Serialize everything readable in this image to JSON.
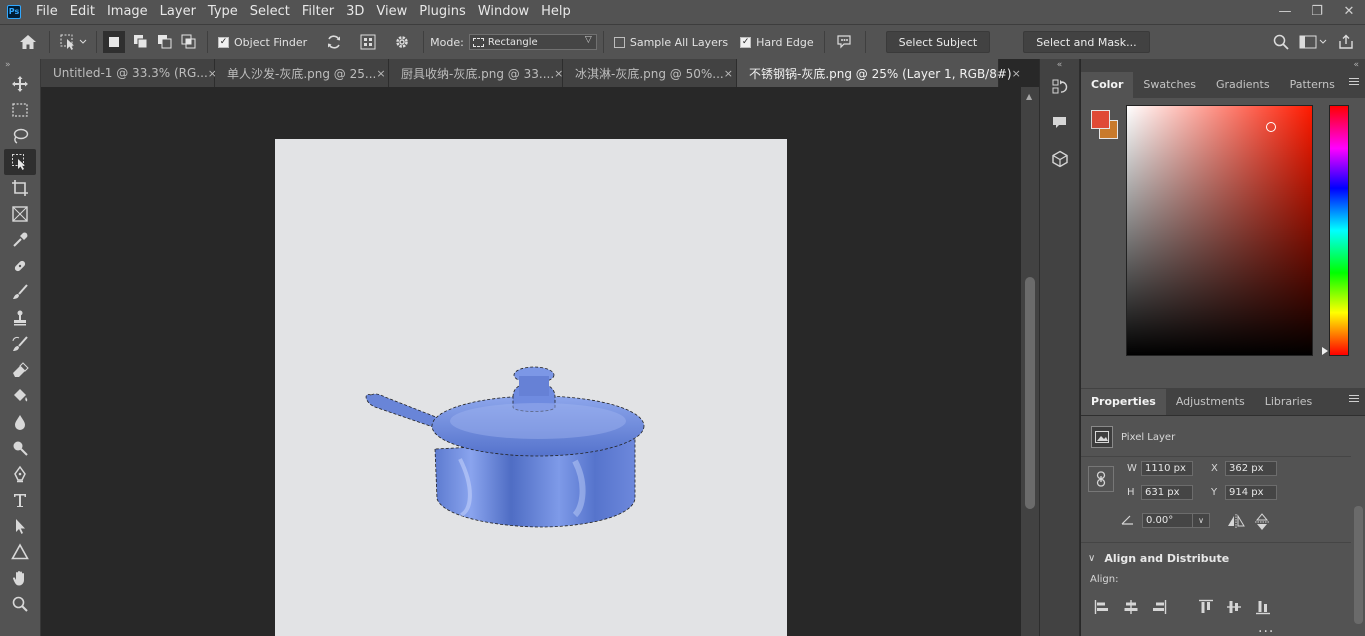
{
  "app": {
    "logo": "Ps"
  },
  "menu": [
    "File",
    "Edit",
    "Image",
    "Layer",
    "Type",
    "Select",
    "Filter",
    "3D",
    "View",
    "Plugins",
    "Window",
    "Help"
  ],
  "window_controls": {
    "minimize": "—",
    "restore": "❐",
    "close": "✕"
  },
  "options": {
    "object_finder_label": "Object Finder",
    "object_finder_checked": true,
    "mode_label": "Mode:",
    "mode_value": "Rectangle",
    "sample_all_layers_label": "Sample All Layers",
    "sample_all_layers_checked": false,
    "hard_edge_label": "Hard Edge",
    "hard_edge_checked": true,
    "select_subject_label": "Select Subject",
    "select_and_mask_label": "Select and Mask..."
  },
  "tabs": [
    {
      "label": "Untitled-1 @ 33.3% (RG...",
      "active": false
    },
    {
      "label": "单人沙发-灰底.png @ 25...",
      "active": false
    },
    {
      "label": "厨具收纳-灰底.png @ 33....",
      "active": false
    },
    {
      "label": "冰淇淋-灰底.png @ 50%...",
      "active": false
    },
    {
      "label": "不锈钢锅-灰底.png @ 25% (Layer 1, RGB/8#)",
      "active": true
    }
  ],
  "tab_close_glyph": "×",
  "color_panel": {
    "tabs": [
      "Color",
      "Swatches",
      "Gradients",
      "Patterns"
    ],
    "foreground": "#e04a36",
    "background": "#c87a2c"
  },
  "properties_panel": {
    "tabs": [
      "Properties",
      "Adjustments",
      "Libraries"
    ],
    "layer_type": "Pixel Layer",
    "w_label": "W",
    "w_value": "1110 px",
    "h_label": "H",
    "h_value": "631 px",
    "x_label": "X",
    "x_value": "362 px",
    "y_label": "Y",
    "y_value": "914 px",
    "angle_value": "0.00°",
    "align_section_title": "Align and Distribute",
    "align_label": "Align:",
    "more_glyph": "..."
  }
}
